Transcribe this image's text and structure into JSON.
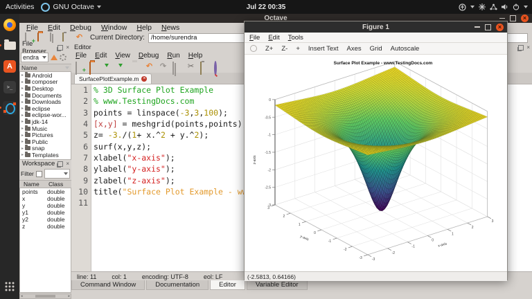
{
  "top_bar": {
    "activities": "Activities",
    "app_menu": "GNU Octave",
    "clock": "Jul 22 00:35"
  },
  "dock": {
    "items": [
      "firefox",
      "files",
      "ubuntu-software",
      "terminal",
      "octave"
    ],
    "show_apps": "show-applications"
  },
  "octave_window": {
    "title": "Octave",
    "menus": [
      "File",
      "Edit",
      "Debug",
      "Window",
      "Help",
      "News"
    ],
    "toolbar": {
      "current_directory_label": "Current Directory:",
      "current_directory_value": "/home/surendra"
    },
    "file_browser": {
      "title": "File Browser",
      "path_combo": "endra",
      "column_header": "Name",
      "folders": [
        "Android",
        "composer",
        "Desktop",
        "Documents",
        "Downloads",
        "eclipse",
        "eclipse-wor...",
        "jdk-14",
        "Music",
        "Pictures",
        "Public",
        "snap",
        "Templates"
      ]
    },
    "workspace": {
      "title": "Workspace",
      "filter_label": "Filter",
      "columns": [
        "Name",
        "Class"
      ],
      "variables": [
        {
          "name": "points",
          "class": "double"
        },
        {
          "name": "x",
          "class": "double"
        },
        {
          "name": "y",
          "class": "double"
        },
        {
          "name": "y1",
          "class": "double"
        },
        {
          "name": "y2",
          "class": "double"
        },
        {
          "name": "z",
          "class": "double"
        }
      ]
    },
    "editor": {
      "title": "Editor",
      "menus": [
        "File",
        "Edit",
        "View",
        "Debug",
        "Run",
        "Help"
      ],
      "toolbar_icons": [
        "new-file",
        "open-file",
        "save",
        "save-as",
        "print",
        "undo",
        "redo",
        "copy",
        "cut",
        "paste",
        "find"
      ],
      "tab_name": "SurfacePlotExample.m",
      "code_lines": [
        {
          "n": "1",
          "segs": [
            [
              "% 3D Surface Plot Example",
              "com"
            ]
          ]
        },
        {
          "n": "2",
          "segs": [
            [
              "% www.TestingDocs.com",
              "com"
            ]
          ]
        },
        {
          "n": "3",
          "segs": [
            [
              "points = linspace(",
              "def"
            ],
            [
              "-3",
              "num"
            ],
            [
              ",",
              "def"
            ],
            [
              "3",
              "num"
            ],
            [
              ",",
              "def"
            ],
            [
              "100",
              "num"
            ],
            [
              ");",
              "def"
            ]
          ]
        },
        {
          "n": "4",
          "segs": [
            [
              "[x,y]",
              "brk"
            ],
            [
              " = meshgrid(points,points);",
              "def"
            ]
          ]
        },
        {
          "n": "5",
          "segs": [
            [
              "z= ",
              "def"
            ],
            [
              "-3.",
              "num"
            ],
            [
              "/(",
              "def"
            ],
            [
              "1",
              "num"
            ],
            [
              "+ x.^",
              "def"
            ],
            [
              "2",
              "num"
            ],
            [
              " + y.^",
              "def"
            ],
            [
              "2",
              "num"
            ],
            [
              ");",
              "def"
            ]
          ]
        },
        {
          "n": "6",
          "segs": [
            [
              "surf(x,y,z);",
              "def"
            ]
          ]
        },
        {
          "n": "7",
          "segs": [
            [
              "xlabel(",
              "def"
            ],
            [
              "\"x-axis\"",
              "str"
            ],
            [
              ");",
              "def"
            ]
          ]
        },
        {
          "n": "8",
          "segs": [
            [
              "ylabel(",
              "def"
            ],
            [
              "\"y-axis\"",
              "str"
            ],
            [
              ");",
              "def"
            ]
          ]
        },
        {
          "n": "9",
          "segs": [
            [
              "zlabel(",
              "def"
            ],
            [
              "\"z-axis\"",
              "str"
            ],
            [
              ");",
              "def"
            ]
          ]
        },
        {
          "n": "10",
          "segs": [
            [
              "title(",
              "def"
            ],
            [
              "\"Surface Plot Example - www.TestingDocs.com\"",
              "str2"
            ],
            [
              ");",
              "def"
            ]
          ]
        },
        {
          "n": "11",
          "segs": []
        }
      ],
      "status": {
        "line": "line: 11",
        "col": "col: 1",
        "encoding": "encoding: UTF-8",
        "eol": "eol: LF"
      }
    },
    "bottom_tabs": {
      "items": [
        "Command Window",
        "Documentation",
        "Editor",
        "Variable Editor"
      ],
      "active": "Editor"
    }
  },
  "figure_window": {
    "title": "Figure 1",
    "menus": [
      "File",
      "Edit",
      "Tools"
    ],
    "tool_buttons": [
      "Z+",
      "Z-",
      "+",
      "Insert Text",
      "Axes",
      "Grid",
      "Autoscale"
    ],
    "status_coords": "(-2.5813, 0.64166)",
    "chart_data": {
      "type": "3d-surface",
      "title": "Surface Plot Example - www.TestingDocs.com",
      "xlabel": "x-axis",
      "ylabel": "y-axis",
      "zlabel": "z-axis",
      "expression": "z = -3./(1 + x.^2 + y.^2)",
      "x_range": [
        -3,
        3
      ],
      "y_range": [
        -3,
        3
      ],
      "z_range": [
        -3,
        0
      ],
      "x_ticks": [
        -3,
        -2,
        -1,
        0,
        1,
        2,
        3
      ],
      "y_ticks": [
        3,
        2,
        1,
        0,
        -1,
        -2,
        -3
      ],
      "z_ticks": [
        0,
        -0.5,
        -1,
        -1.5,
        -2,
        -2.5,
        -3
      ],
      "mesh_n": 100,
      "colormap": "viridis",
      "color_limits": [
        -3,
        -0.1579
      ],
      "grid": true
    }
  },
  "colors": {
    "accent_orange": "#e95420",
    "titlebar": "#2e2a28",
    "panel_bg": "#d6d2ce"
  }
}
